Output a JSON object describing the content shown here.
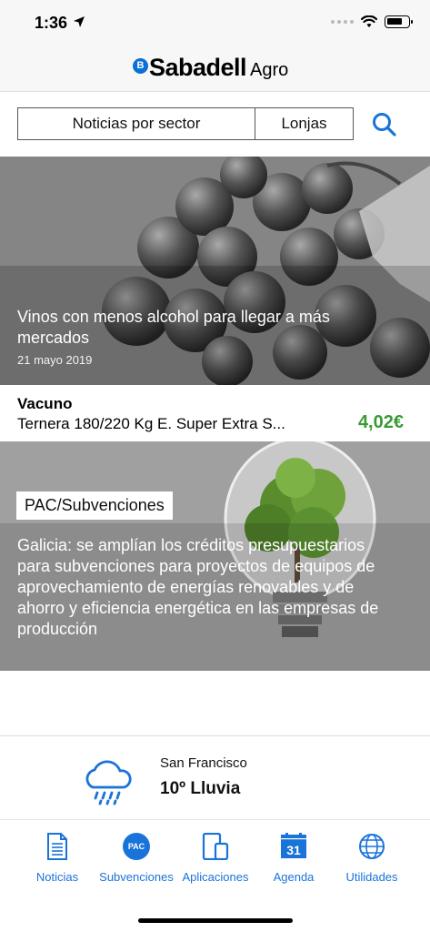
{
  "status_bar": {
    "time": "1:36"
  },
  "header": {
    "logo_badge": "B",
    "brand": "Sabadell",
    "brand_sub": "Agro"
  },
  "filters": {
    "sector_label": "Noticias por sector",
    "lonjas_label": "Lonjas"
  },
  "hero": {
    "title": "Vinos con menos alcohol para llegar a más mercados",
    "date": "21 mayo 2019"
  },
  "price": {
    "category": "Vacuno",
    "product": "Ternera 180/220 Kg E. Super Extra S...",
    "value": "4,02€",
    "value_color": "#3a9a33"
  },
  "pac_card": {
    "tag": "PAC/Subvenciones",
    "title": "Galicia: se amplían los créditos presupuestarios para subvenciones para proyectos de equipos de aprovechamiento de energías renovables y de ahorro y eficiencia energética en las empresas de producción"
  },
  "weather": {
    "city": "San Francisco",
    "condition": "10º Lluvia",
    "icon": "rain-cloud-icon"
  },
  "tabs": [
    {
      "label": "Noticias",
      "icon": "document-icon"
    },
    {
      "label": "Subvenciones",
      "icon": "pac-icon",
      "icon_text": "PAC"
    },
    {
      "label": "Aplicaciones",
      "icon": "devices-icon"
    },
    {
      "label": "Agenda",
      "icon": "calendar-icon",
      "icon_text": "31"
    },
    {
      "label": "Utilidades",
      "icon": "globe-icon"
    }
  ],
  "colors": {
    "accent": "#1a73d9",
    "brand_blue": "#0b6fd6",
    "price_green": "#3a9a33"
  }
}
